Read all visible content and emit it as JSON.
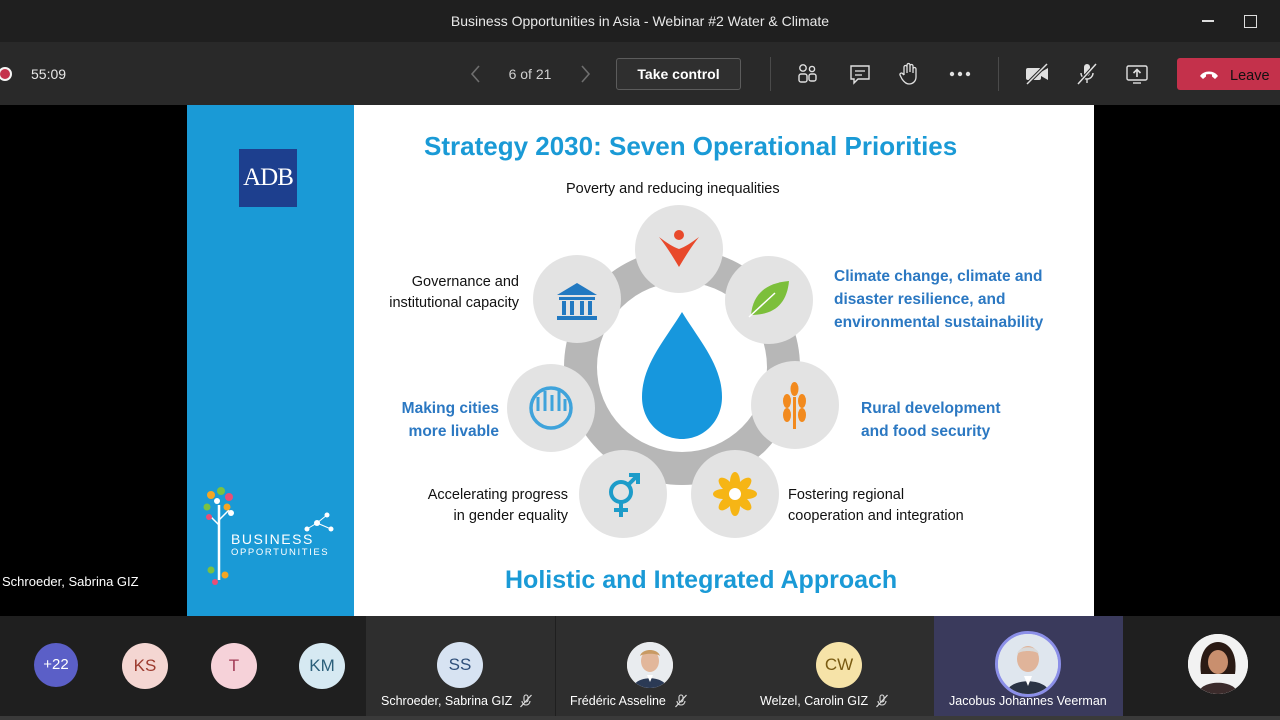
{
  "window": {
    "title": "Business Opportunities in Asia - Webinar #2 Water & Climate"
  },
  "toolbar": {
    "timer": "55:09",
    "page_counter": "6 of 21",
    "take_control_label": "Take control",
    "leave_label": "Leave",
    "colors": {
      "leave": "#c4314b",
      "recording": "#c4314b"
    }
  },
  "stage": {
    "presenter_name": "Schroeder, Sabrina GIZ"
  },
  "slide": {
    "title": "Strategy 2030: Seven Operational Priorities",
    "logo_text": "ADB",
    "brand_line1": "BUSINESS",
    "brand_line2": "OPPORTUNITIES",
    "priorities": {
      "top": "Poverty and reducing inequalities",
      "governance": [
        "Governance and",
        "institutional capacity"
      ],
      "climate": [
        "Climate change, climate and",
        "disaster resilience, and",
        "environmental sustainability"
      ],
      "cities": [
        "Making cities",
        "more livable"
      ],
      "rural": [
        "Rural development",
        "and food security"
      ],
      "gender": [
        "Accelerating progress",
        "in gender equality"
      ],
      "regional": [
        "Fostering regional",
        "cooperation and integration"
      ]
    },
    "footer": "Holistic and Integrated Approach",
    "colors": {
      "accent": "#1a9ad6",
      "emphasis": "#2b78c2"
    }
  },
  "participants": {
    "overflow": "+22",
    "initials": [
      "KS",
      "T",
      "KM"
    ],
    "tiles": [
      {
        "initials": "SS",
        "name": "Schroeder, Sabrina GIZ"
      },
      {
        "name": "Frédéric Asseline"
      },
      {
        "initials": "CW",
        "name": "Welzel, Carolin GIZ"
      },
      {
        "name": "Jacobus Johannes Veerman"
      }
    ]
  }
}
